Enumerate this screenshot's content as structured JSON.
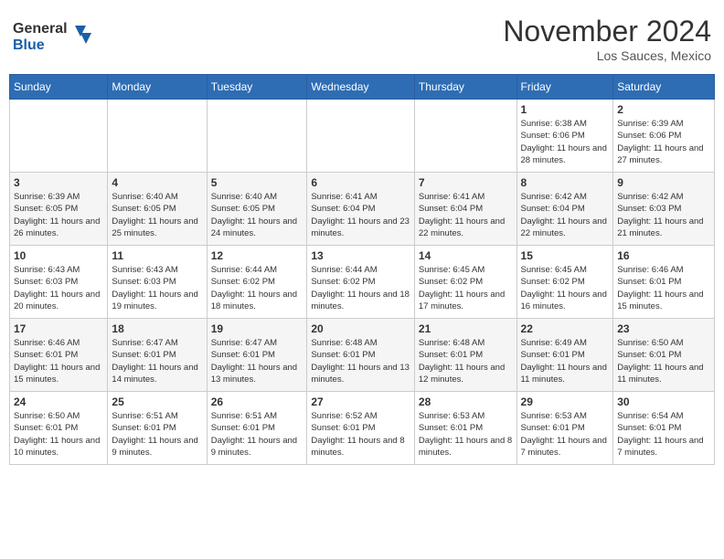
{
  "header": {
    "logo_line1": "General",
    "logo_line2": "Blue",
    "month": "November 2024",
    "location": "Los Sauces, Mexico"
  },
  "weekdays": [
    "Sunday",
    "Monday",
    "Tuesday",
    "Wednesday",
    "Thursday",
    "Friday",
    "Saturday"
  ],
  "weeks": [
    [
      {
        "day": "",
        "info": ""
      },
      {
        "day": "",
        "info": ""
      },
      {
        "day": "",
        "info": ""
      },
      {
        "day": "",
        "info": ""
      },
      {
        "day": "",
        "info": ""
      },
      {
        "day": "1",
        "info": "Sunrise: 6:38 AM\nSunset: 6:06 PM\nDaylight: 11 hours and 28 minutes."
      },
      {
        "day": "2",
        "info": "Sunrise: 6:39 AM\nSunset: 6:06 PM\nDaylight: 11 hours and 27 minutes."
      }
    ],
    [
      {
        "day": "3",
        "info": "Sunrise: 6:39 AM\nSunset: 6:05 PM\nDaylight: 11 hours and 26 minutes."
      },
      {
        "day": "4",
        "info": "Sunrise: 6:40 AM\nSunset: 6:05 PM\nDaylight: 11 hours and 25 minutes."
      },
      {
        "day": "5",
        "info": "Sunrise: 6:40 AM\nSunset: 6:05 PM\nDaylight: 11 hours and 24 minutes."
      },
      {
        "day": "6",
        "info": "Sunrise: 6:41 AM\nSunset: 6:04 PM\nDaylight: 11 hours and 23 minutes."
      },
      {
        "day": "7",
        "info": "Sunrise: 6:41 AM\nSunset: 6:04 PM\nDaylight: 11 hours and 22 minutes."
      },
      {
        "day": "8",
        "info": "Sunrise: 6:42 AM\nSunset: 6:04 PM\nDaylight: 11 hours and 22 minutes."
      },
      {
        "day": "9",
        "info": "Sunrise: 6:42 AM\nSunset: 6:03 PM\nDaylight: 11 hours and 21 minutes."
      }
    ],
    [
      {
        "day": "10",
        "info": "Sunrise: 6:43 AM\nSunset: 6:03 PM\nDaylight: 11 hours and 20 minutes."
      },
      {
        "day": "11",
        "info": "Sunrise: 6:43 AM\nSunset: 6:03 PM\nDaylight: 11 hours and 19 minutes."
      },
      {
        "day": "12",
        "info": "Sunrise: 6:44 AM\nSunset: 6:02 PM\nDaylight: 11 hours and 18 minutes."
      },
      {
        "day": "13",
        "info": "Sunrise: 6:44 AM\nSunset: 6:02 PM\nDaylight: 11 hours and 18 minutes."
      },
      {
        "day": "14",
        "info": "Sunrise: 6:45 AM\nSunset: 6:02 PM\nDaylight: 11 hours and 17 minutes."
      },
      {
        "day": "15",
        "info": "Sunrise: 6:45 AM\nSunset: 6:02 PM\nDaylight: 11 hours and 16 minutes."
      },
      {
        "day": "16",
        "info": "Sunrise: 6:46 AM\nSunset: 6:01 PM\nDaylight: 11 hours and 15 minutes."
      }
    ],
    [
      {
        "day": "17",
        "info": "Sunrise: 6:46 AM\nSunset: 6:01 PM\nDaylight: 11 hours and 15 minutes."
      },
      {
        "day": "18",
        "info": "Sunrise: 6:47 AM\nSunset: 6:01 PM\nDaylight: 11 hours and 14 minutes."
      },
      {
        "day": "19",
        "info": "Sunrise: 6:47 AM\nSunset: 6:01 PM\nDaylight: 11 hours and 13 minutes."
      },
      {
        "day": "20",
        "info": "Sunrise: 6:48 AM\nSunset: 6:01 PM\nDaylight: 11 hours and 13 minutes."
      },
      {
        "day": "21",
        "info": "Sunrise: 6:48 AM\nSunset: 6:01 PM\nDaylight: 11 hours and 12 minutes."
      },
      {
        "day": "22",
        "info": "Sunrise: 6:49 AM\nSunset: 6:01 PM\nDaylight: 11 hours and 11 minutes."
      },
      {
        "day": "23",
        "info": "Sunrise: 6:50 AM\nSunset: 6:01 PM\nDaylight: 11 hours and 11 minutes."
      }
    ],
    [
      {
        "day": "24",
        "info": "Sunrise: 6:50 AM\nSunset: 6:01 PM\nDaylight: 11 hours and 10 minutes."
      },
      {
        "day": "25",
        "info": "Sunrise: 6:51 AM\nSunset: 6:01 PM\nDaylight: 11 hours and 9 minutes."
      },
      {
        "day": "26",
        "info": "Sunrise: 6:51 AM\nSunset: 6:01 PM\nDaylight: 11 hours and 9 minutes."
      },
      {
        "day": "27",
        "info": "Sunrise: 6:52 AM\nSunset: 6:01 PM\nDaylight: 11 hours and 8 minutes."
      },
      {
        "day": "28",
        "info": "Sunrise: 6:53 AM\nSunset: 6:01 PM\nDaylight: 11 hours and 8 minutes."
      },
      {
        "day": "29",
        "info": "Sunrise: 6:53 AM\nSunset: 6:01 PM\nDaylight: 11 hours and 7 minutes."
      },
      {
        "day": "30",
        "info": "Sunrise: 6:54 AM\nSunset: 6:01 PM\nDaylight: 11 hours and 7 minutes."
      }
    ]
  ]
}
